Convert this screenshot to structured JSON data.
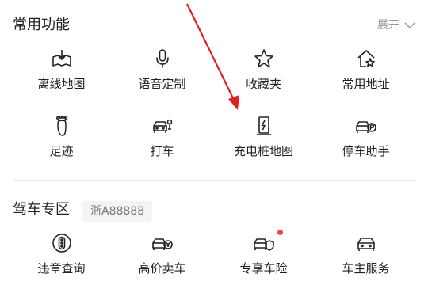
{
  "common": {
    "title": "常用功能",
    "expand_label": "展开",
    "items": [
      {
        "label": "离线地图",
        "icon": "download-map-icon"
      },
      {
        "label": "语音定制",
        "icon": "microphone-icon"
      },
      {
        "label": "收藏夹",
        "icon": "star-icon"
      },
      {
        "label": "常用地址",
        "icon": "home-star-icon"
      },
      {
        "label": "足迹",
        "icon": "footprint-icon"
      },
      {
        "label": "打车",
        "icon": "taxi-icon"
      },
      {
        "label": "充电桩地图",
        "icon": "charging-pile-icon"
      },
      {
        "label": "停车助手",
        "icon": "parking-icon"
      }
    ]
  },
  "drive": {
    "title": "驾车专区",
    "plate": "浙A88888",
    "items": [
      {
        "label": "违章查询",
        "icon": "violation-icon"
      },
      {
        "label": "高价卖车",
        "icon": "sell-car-icon"
      },
      {
        "label": "专享车险",
        "icon": "car-insurance-icon",
        "badge": true
      },
      {
        "label": "车主服务",
        "icon": "car-service-icon"
      }
    ]
  },
  "colors": {
    "arrow": "#e02020",
    "badge": "#f2453d",
    "text": "#222222",
    "muted": "#999999"
  }
}
